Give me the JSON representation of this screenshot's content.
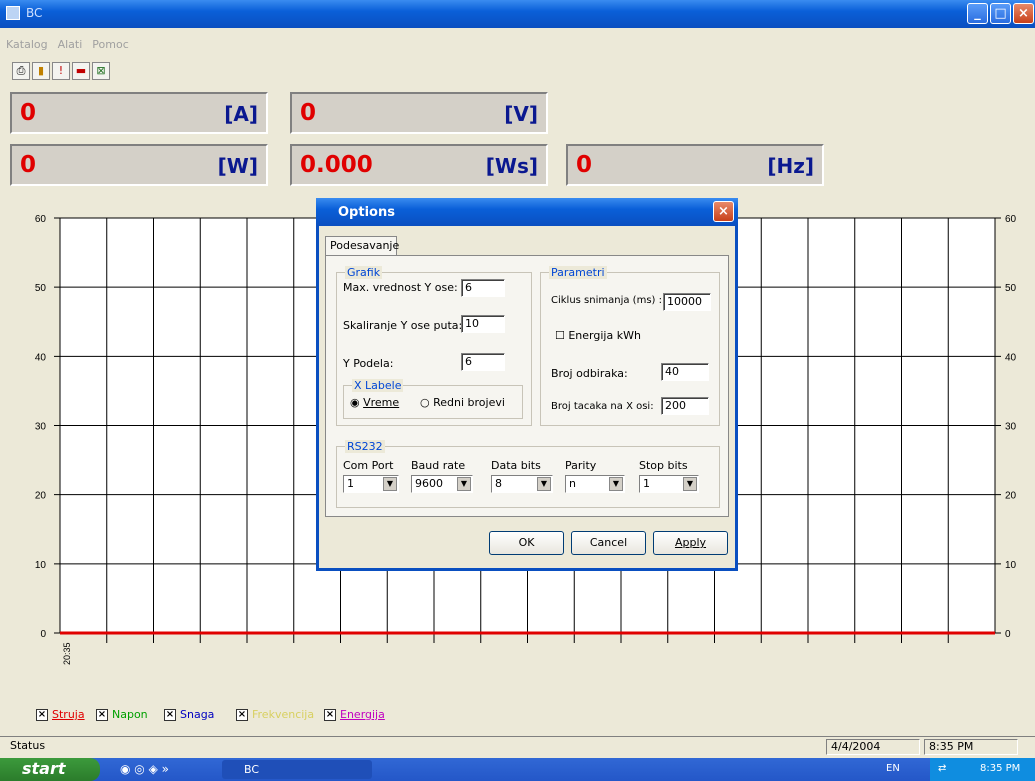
{
  "window": {
    "title": "BC"
  },
  "menu": [
    "Katalog",
    "Alati",
    "Pomoc"
  ],
  "toolbar": [
    "print-icon",
    "plug-icon",
    "alert-icon",
    "exit-icon",
    "excel-icon"
  ],
  "panels": [
    {
      "value": "0",
      "unit": "[A]"
    },
    {
      "value": "0",
      "unit": "[V]"
    },
    {
      "value": "0",
      "unit": "[W]"
    },
    {
      "value": "0.000",
      "unit": "[Ws]"
    },
    {
      "value": "0",
      "unit": "[Hz]"
    }
  ],
  "chart_data": {
    "type": "line",
    "ylim": [
      0,
      60
    ],
    "yticks": [
      0,
      10,
      20,
      30,
      40,
      50,
      60
    ],
    "xticks": [
      "20:35"
    ],
    "grid": true,
    "series": [
      {
        "name": "Struja",
        "color": "#e00000",
        "values": [
          0,
          0
        ]
      }
    ]
  },
  "legend": [
    {
      "label": "Struja",
      "color": "#e00000"
    },
    {
      "label": "Napon",
      "color": "#00a000"
    },
    {
      "label": "Snaga",
      "color": "#0000c0"
    },
    {
      "label": "Frekvencija",
      "color": "#d8d060"
    },
    {
      "label": "Energija",
      "color": "#c000c0"
    }
  ],
  "status": {
    "label": "Status",
    "date": "4/4/2004",
    "time": "8:35 PM"
  },
  "taskbar": {
    "start": "start",
    "task": "BC",
    "lang": "EN",
    "clock": "8:35 PM"
  },
  "dialog": {
    "title": "Options",
    "tab": "Podesavanje",
    "grafik": {
      "legend": "Grafik",
      "max_label": "Max. vrednost Y ose:",
      "max_value": "6",
      "scale_label": "Skaliranje Y ose puta:",
      "scale_value": "10",
      "div_label": "Y Podela:",
      "div_value": "6"
    },
    "xlabele": {
      "legend": "X Labele",
      "opt1": "Vreme",
      "opt2": "Redni brojevi"
    },
    "parametri": {
      "legend": "Parametri",
      "cycle_label": "Ciklus snimanja (ms) :",
      "cycle_value": "10000",
      "energy_label": "Energija kWh",
      "samples_label": "Broj odbiraka:",
      "samples_value": "40",
      "points_label": "Broj tacaka na X osi:",
      "points_value": "200"
    },
    "rs232": {
      "legend": "RS232",
      "fields": [
        {
          "label": "Com Port",
          "value": "1"
        },
        {
          "label": "Baud rate",
          "value": "9600"
        },
        {
          "label": "Data bits",
          "value": "8"
        },
        {
          "label": "Parity",
          "value": "n"
        },
        {
          "label": "Stop bits",
          "value": "1"
        }
      ]
    },
    "buttons": {
      "ok": "OK",
      "cancel": "Cancel",
      "apply": "Apply"
    }
  }
}
